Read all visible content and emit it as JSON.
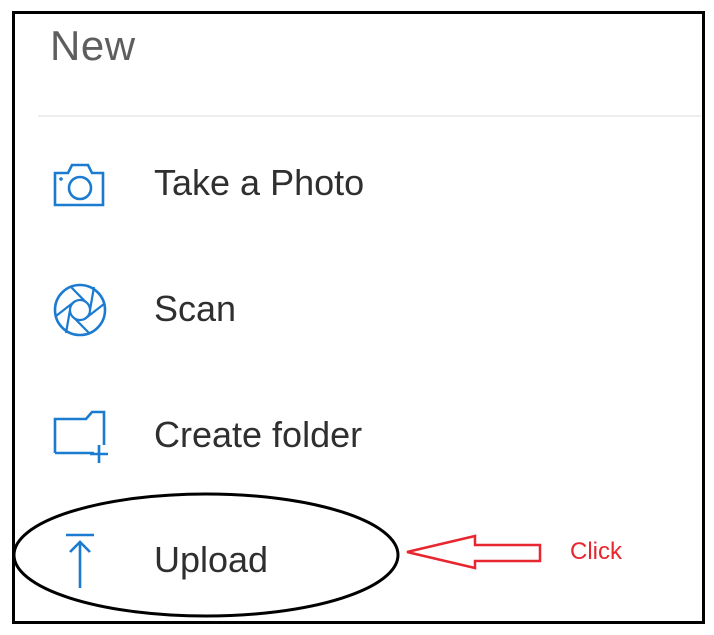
{
  "menu": {
    "title": "New",
    "items": [
      {
        "label": "Take a Photo",
        "icon": "camera-icon"
      },
      {
        "label": "Scan",
        "icon": "aperture-icon"
      },
      {
        "label": "Create folder",
        "icon": "folder-add-icon"
      },
      {
        "label": "Upload",
        "icon": "upload-icon"
      }
    ]
  },
  "annotation": {
    "callout_text": "Click",
    "callout_color": "#e8262f",
    "ellipse_color": "#000000"
  },
  "colors": {
    "icon": "#1a7bd1",
    "title": "#5e5e5e",
    "label": "#2f2f2f",
    "frame": "#000000"
  }
}
